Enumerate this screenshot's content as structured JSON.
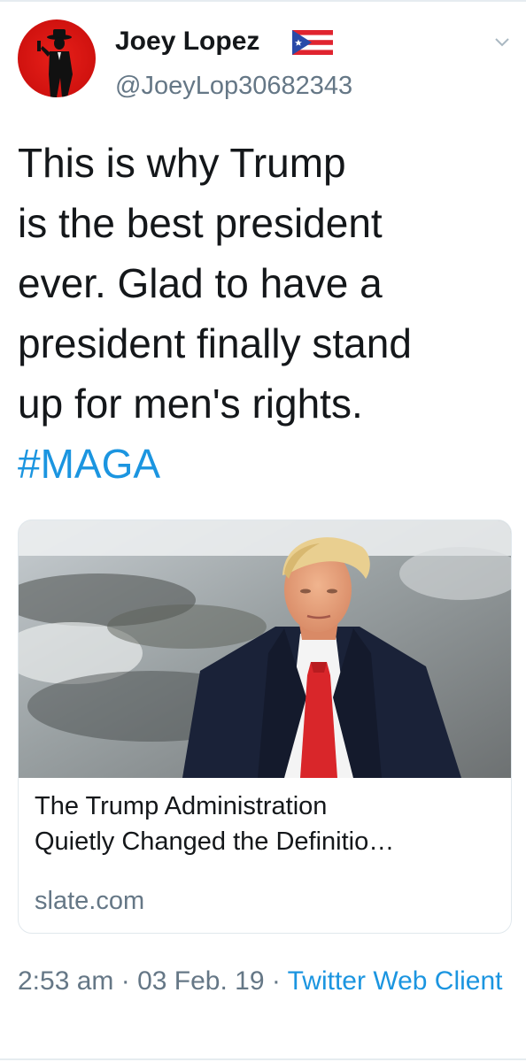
{
  "author": {
    "name": "Joey Lopez",
    "handle": "@JoeyLop30682343",
    "flag_icon": "puerto-rico-flag-icon"
  },
  "tweet": {
    "lines": [
      "This is why Trump",
      "is the best president",
      "ever. Glad to have a",
      "president finally stand",
      "up for men's rights."
    ],
    "hashtag": "#MAGA"
  },
  "card": {
    "title_lines": [
      "The Trump Administration",
      "Quietly Changed the Definitio…"
    ],
    "domain": "slate.com"
  },
  "meta": {
    "time": "2:53 am",
    "separator": " · ",
    "date": "03 Feb. 19",
    "separator2": " · ",
    "source": "Twitter Web Client"
  },
  "colors": {
    "link": "#1b95e0",
    "secondary": "#657786",
    "primary_text": "#14171a",
    "avatar_red": "#d0120f"
  }
}
